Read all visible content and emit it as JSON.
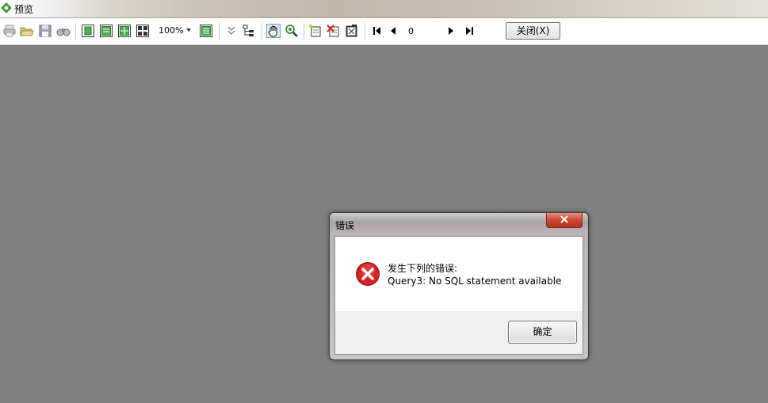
{
  "window": {
    "title": "预览"
  },
  "toolbar": {
    "zoom_value": "100%",
    "page_value": "0",
    "close_label": "关闭(X)",
    "icons": [
      "printer-icon",
      "open-folder-icon",
      "save-icon",
      "find-icon",
      "page-view-icon",
      "page-width-icon",
      "multi-page-icon",
      "four-pages-icon",
      "outline-icon",
      "collapse-icon",
      "tree-icon",
      "hand-icon",
      "zoom-in-icon",
      "add-page-icon",
      "delete-page-icon",
      "edit-page-icon",
      "first-page-icon",
      "prev-page-icon",
      "next-page-icon",
      "last-page-icon"
    ]
  },
  "dialog": {
    "title": "错误",
    "message_line1": "发生下列的错误:",
    "message_line2": "Query3: No SQL statement available",
    "ok_label": "确定",
    "icon": "error-icon"
  },
  "colors": {
    "workspace": "#808080",
    "dialog_close": "#c84a33",
    "error_red": "#d42020"
  }
}
